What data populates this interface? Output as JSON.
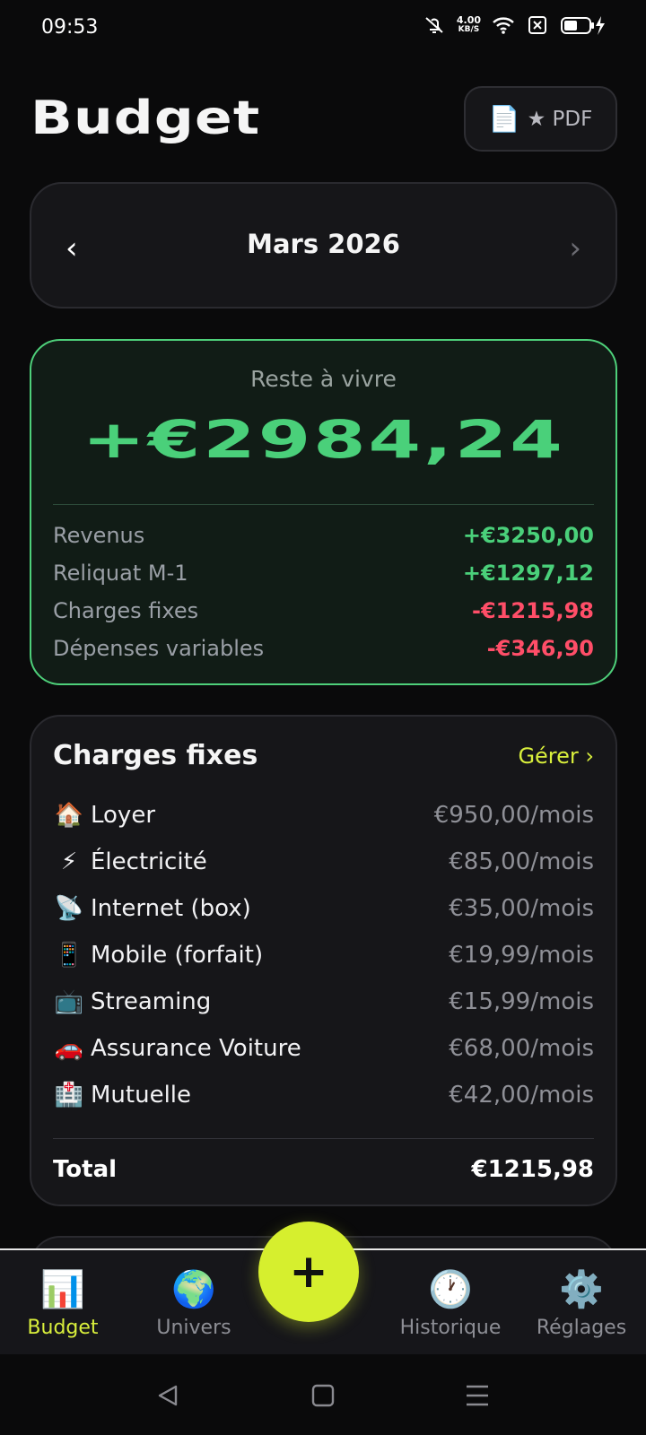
{
  "status": {
    "time": "09:53",
    "speed_top": "4.00",
    "speed_bottom": "KB/S",
    "icons": [
      "mute-bell-icon",
      "wifi-icon",
      "sim-off-icon",
      "battery-charging-icon"
    ]
  },
  "header": {
    "title": "Budget",
    "pdf_label": "★ PDF",
    "pdf_icon": "📄"
  },
  "month": {
    "prev": "‹",
    "label": "Mars 2026",
    "next": "›"
  },
  "summary": {
    "label": "Reste à vivre",
    "amount": "+€2984,24",
    "rows": [
      {
        "label": "Revenus",
        "value": "+€3250,00",
        "sign": "pos"
      },
      {
        "label": "Reliquat M-1",
        "value": "+€1297,12",
        "sign": "pos"
      },
      {
        "label": "Charges fixes",
        "value": "-€1215,98",
        "sign": "neg"
      },
      {
        "label": "Dépenses variables",
        "value": "-€346,90",
        "sign": "neg"
      }
    ],
    "colors": {
      "positive": "#4ad07a",
      "negative": "#ff4e68",
      "border": "#4ed07a"
    }
  },
  "charges": {
    "title": "Charges fixes",
    "manage": "Gérer ›",
    "items": [
      {
        "icon": "🏠",
        "name": "Loyer",
        "amount": "€950,00/mois"
      },
      {
        "icon": "⚡",
        "name": "Électricité",
        "amount": "€85,00/mois"
      },
      {
        "icon": "📡",
        "name": "Internet (box)",
        "amount": "€35,00/mois"
      },
      {
        "icon": "📱",
        "name": "Mobile (forfait)",
        "amount": "€19,99/mois"
      },
      {
        "icon": "📺",
        "name": "Streaming",
        "amount": "€15,99/mois"
      },
      {
        "icon": "🚗",
        "name": "Assurance Voiture",
        "amount": "€68,00/mois"
      },
      {
        "icon": "🏥",
        "name": "Mutuelle",
        "amount": "€42,00/mois"
      }
    ],
    "total_label": "Total",
    "total_value": "€1215,98"
  },
  "nav": {
    "items": [
      {
        "icon": "📊",
        "label": "Budget"
      },
      {
        "icon": "🌍",
        "label": "Univers"
      },
      {
        "icon": "🕐",
        "label": "Historique"
      },
      {
        "icon": "⚙️",
        "label": "Réglages"
      }
    ],
    "fab": "+",
    "accent": "#d6ef2e"
  }
}
